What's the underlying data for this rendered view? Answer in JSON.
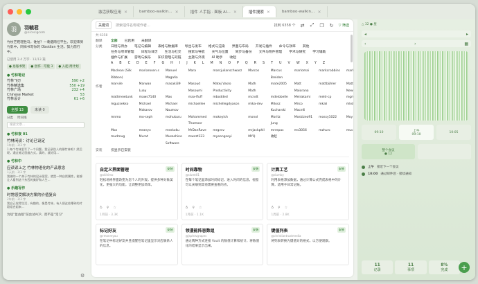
{
  "window": {
    "traffic": [
      "#fe5f57",
      "#febc2e",
      "#28c840"
    ],
    "tabs": [
      {
        "label": "激活获取应用",
        "active": false
      },
      {
        "label": "bamboo-walkin…",
        "active": false
      },
      {
        "label": "插件 人手指 · 面板 AI…",
        "active": false
      },
      {
        "label": "插件搜索",
        "active": true
      },
      {
        "label": "bamboo-walkin…",
        "active": false
      }
    ]
  },
  "sidebar": {
    "avatar_letter": "羽",
    "name": "羽毓君",
    "handle": "@nicecigcom",
    "bio": "竹杖芒鞋轻胜马，谁怕？一蓑烟雨任平生。欢迎来到竹影中，同样书写你的 Obsidian 生活，努力前行中。",
    "meta": "已使用 3.4 万字 · 13/13 篇",
    "chips": [
      "● 总账书架",
      "● 创作 · 可能 3",
      "● 入起·周计划"
    ],
    "section1_title": "● 竹林笔记",
    "section1_rows": [
      {
        "k": "竹林飞刃",
        "v": "590 +2"
      },
      {
        "k": "竹林精选集",
        "v": "550 +19"
      },
      {
        "k": "竹林广场",
        "v": "232 +4"
      },
      {
        "k": "Chinese Market",
        "v": "53"
      },
      {
        "k": "竹林设计",
        "v": "61 +6"
      }
    ],
    "filter_all": "全部 13",
    "filter_star": "未读 0",
    "subnav": [
      "分类",
      "时间线"
    ],
    "search_placeholder": "搜索文章...",
    "notes": [
      {
        "tag": "● 竹林夜 01",
        "title": "竹林闲谈：讨论已设定",
        "meta": "1年前 · 3/3 字",
        "body": "1.每个竹林里写了一个问题，我记录别人的聊竹林吧！然后呢，通过笔记思维方式，真的、就好用..."
      },
      {
        "tag": "● 竹林中",
        "title": "应读读上之 竹林物语化的产品意念",
        "meta": "1天前 · 3/3 字",
        "body": "我做的一个关于竹林的设计图案，就是一种自然属性，能够让人看到这个东西的美好和人生..."
      },
      {
        "tag": "● 乐趣写作",
        "title": "时常感受解决方案的价值复合",
        "meta": "2年前 · 3/3 字",
        "body": "我自己觉得生活，有趣的，像是竹林，有人把这些零碎的片段组合起来..."
      }
    ],
    "footer_text": "为啥“复古版”前台试ACP，而不是“常习”"
  },
  "center": {
    "keyword_label": "关键词",
    "search_placeholder": "搜索插件名称或作者...",
    "count_text": "找到 6358 个",
    "filter_label": "▽ 筛选",
    "total_text": "共 6358",
    "rows": [
      {
        "label": "翻译",
        "items": [
          "全部",
          "已启用",
          "未翻译"
        ],
        "on": 0
      },
      {
        "label": "分类",
        "items": [
          "日程与待办",
          "笔记与编辑",
          "表格与数据库",
          "导出与发布",
          "格式与渲染",
          "界面与布局",
          "开发与插件",
          "命令与效率",
          "其他"
        ],
        "on": -1
      },
      {
        "label": "",
        "items": [
          "任务与项目管理",
          "日程与日历",
          "生活与社交",
          "搜索与导航",
          "天气与位置",
          "同步与备份",
          "文件与附件管理",
          "学术与研究",
          "学习辅助"
        ],
        "on": -1
      },
      {
        "label": "",
        "items": [
          "插件与扩展",
          "游戏与娱乐",
          "知识管理与双链",
          "主题与外观",
          "AI 助手",
          "收起"
        ],
        "on": -1
      }
    ],
    "letters": [
      "A",
      "B",
      "C",
      "D",
      "E",
      "F",
      "G",
      "H",
      "I",
      "J",
      "K",
      "L",
      "M",
      "N",
      "O",
      "P",
      "Q",
      "R",
      "S",
      "T",
      "U",
      "V",
      "W",
      "X",
      "Y",
      "Z"
    ],
    "author_label": "作者",
    "authors": [
      "Maclean (Silk Ribbon)",
      "mariarosen.s",
      "Manuel Magaña",
      "Mara",
      "marcjulianschwarz",
      "Marcos",
      "Marcus Breiden",
      "marlomai",
      "markcrobbins",
      "marktindckim",
      "marvile",
      "Marwan Luay",
      "masaki39",
      "Masoud Masoumi",
      "Matej Vasro Productivity",
      "Math Math",
      "mate2005",
      "Matt Maiorana",
      "mattbühler",
      "Matthew Newton",
      "mattmewtunk",
      "maws7140",
      "Max",
      "max-fluff",
      "mbodded",
      "mcndt",
      "mdelobelle",
      "Meirakami",
      "meld-cp",
      "mgmeyers",
      "mguzsekko",
      "Michael Makarov",
      "Michael Naumov",
      "michaellee",
      "michellegdyason",
      "mika-dev",
      "Milosz Kucharski",
      "Mirco Macelli",
      "mkali",
      "mkshp-dev",
      "mnmo",
      "mo-seph",
      "mohukuru",
      "Mohammed Thamoor",
      "mokeyish",
      "monol",
      "Moritz Jung",
      "Moskizeo91",
      "mossy1022",
      "Moy",
      "Moz",
      "mranyx",
      "msnkoku",
      "MrDanRave",
      "mrgvsv",
      "mrjackphil",
      "mrrepac",
      "ms3056",
      "mzhurc",
      "muckmuck96",
      "mudmug",
      "Murat",
      "Musashino Software",
      "mwczt123",
      "myeongsoyi",
      "MYQ",
      "收起"
    ],
    "install_label": "安装",
    "install_items": [
      "仅显示已安装"
    ],
    "cards": [
      {
        "title": "自定义界面管理",
        "author": "@skihimo",
        "desc": "轻松地将界面改变为您个人的外观，提供多种对象美化，更强大的功能，让调整更加简单。",
        "badge": "安装",
        "foot": "1月前 · 3.3K",
        "icons": true
      },
      {
        "title": "时间靠物",
        "author": "@slumt01",
        "desc": "在每个笔记里添加时间标记，进入时间的信息，视窗可以关联到其他需要查看的点。",
        "badge": "安装",
        "foot": "1月前 · 1.1K",
        "icons": true
      },
      {
        "title": "计算工艺",
        "author": "@slumby",
        "desc": "利用表格添加数据，通过计算公式完成表格中的计算，适用于日常记账。",
        "badge": "安装",
        "foot": "1周前 · 2.8K",
        "icons": true
      },
      {
        "title": "标记好友",
        "author": "@rmonreyou",
        "desc": "在笔记中标记好友并且提醒在笔记里显示对应联系人的信息。",
        "badge": "安装",
        "foot": "",
        "icons": false
      },
      {
        "title": "领漫能阵容数组",
        "author": "@jsplstvgrapes",
        "desc": "通过两种方式连接 Vault 的数值计算和统计，将数值化的结果显示出来。",
        "badge": "安装",
        "foot": "",
        "icons": false
      },
      {
        "title": "键值列表",
        "author": "@christiantrustmedia",
        "desc": "将列表转换为键值对的格式，以方便观察。",
        "badge": "安装",
        "foot": "",
        "icons": false
      }
    ]
  },
  "right": {
    "top_text": "△ 32 ● 星",
    "tiles1": [
      {
        "a": "09:10",
        "b": "",
        "state": ""
      },
      {
        "a": "上午",
        "b": "09:10",
        "state": "hi"
      },
      {
        "a": "10:05",
        "b": "",
        "state": ""
      }
    ],
    "tiles2": [
      {
        "a": "整个会议",
        "b": "● 12",
        "state": "sel"
      },
      {
        "a": "",
        "b": "",
        "state": ""
      }
    ],
    "timeline": [
      {
        "label": "上午",
        "text": "接近下一个会议"
      },
      {
        "label": "10:00",
        "text": "通过邮件后 · 接续通知"
      }
    ],
    "stats": [
      {
        "v": "11",
        "l": "记录"
      },
      {
        "v": "11",
        "l": "事项"
      },
      {
        "v": "8%",
        "l": "完成"
      }
    ],
    "fab": "+"
  }
}
